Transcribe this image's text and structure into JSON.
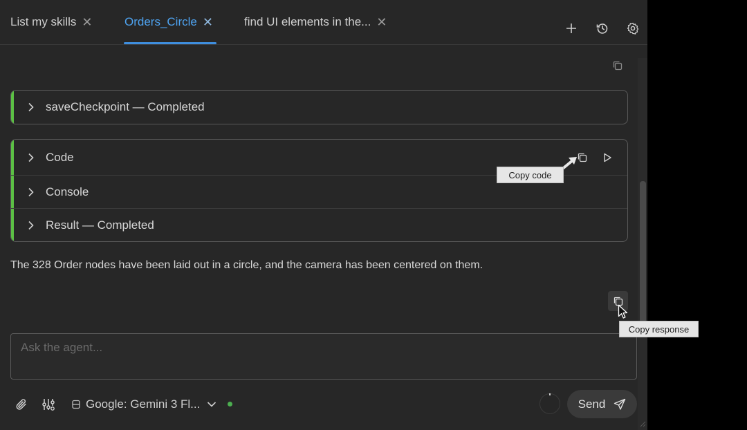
{
  "tabs": [
    {
      "label": "List my skills",
      "close": "✕"
    },
    {
      "label": "Orders_Circle",
      "close": "✕"
    },
    {
      "label": "find UI elements in the...",
      "close": "✕"
    }
  ],
  "toolbar": {
    "new_icon": "plus-icon",
    "history_icon": "history-icon",
    "settings_icon": "gear-icon"
  },
  "steps": {
    "checkpoint": "saveCheckpoint — Completed",
    "code": "Code",
    "console": "Console",
    "result": "Result — Completed"
  },
  "tooltips": {
    "copy_code": "Copy code",
    "copy_response": "Copy response"
  },
  "message": "The 328 Order nodes have been laid out in a circle, and the camera has been centered on them.",
  "composer": {
    "placeholder": "Ask the agent...",
    "model": "Google: Gemini 3 Fl...",
    "send_label": "Send"
  },
  "colors": {
    "accent": "#4ea3f0",
    "status_green": "#5cc045",
    "background": "#272727"
  }
}
